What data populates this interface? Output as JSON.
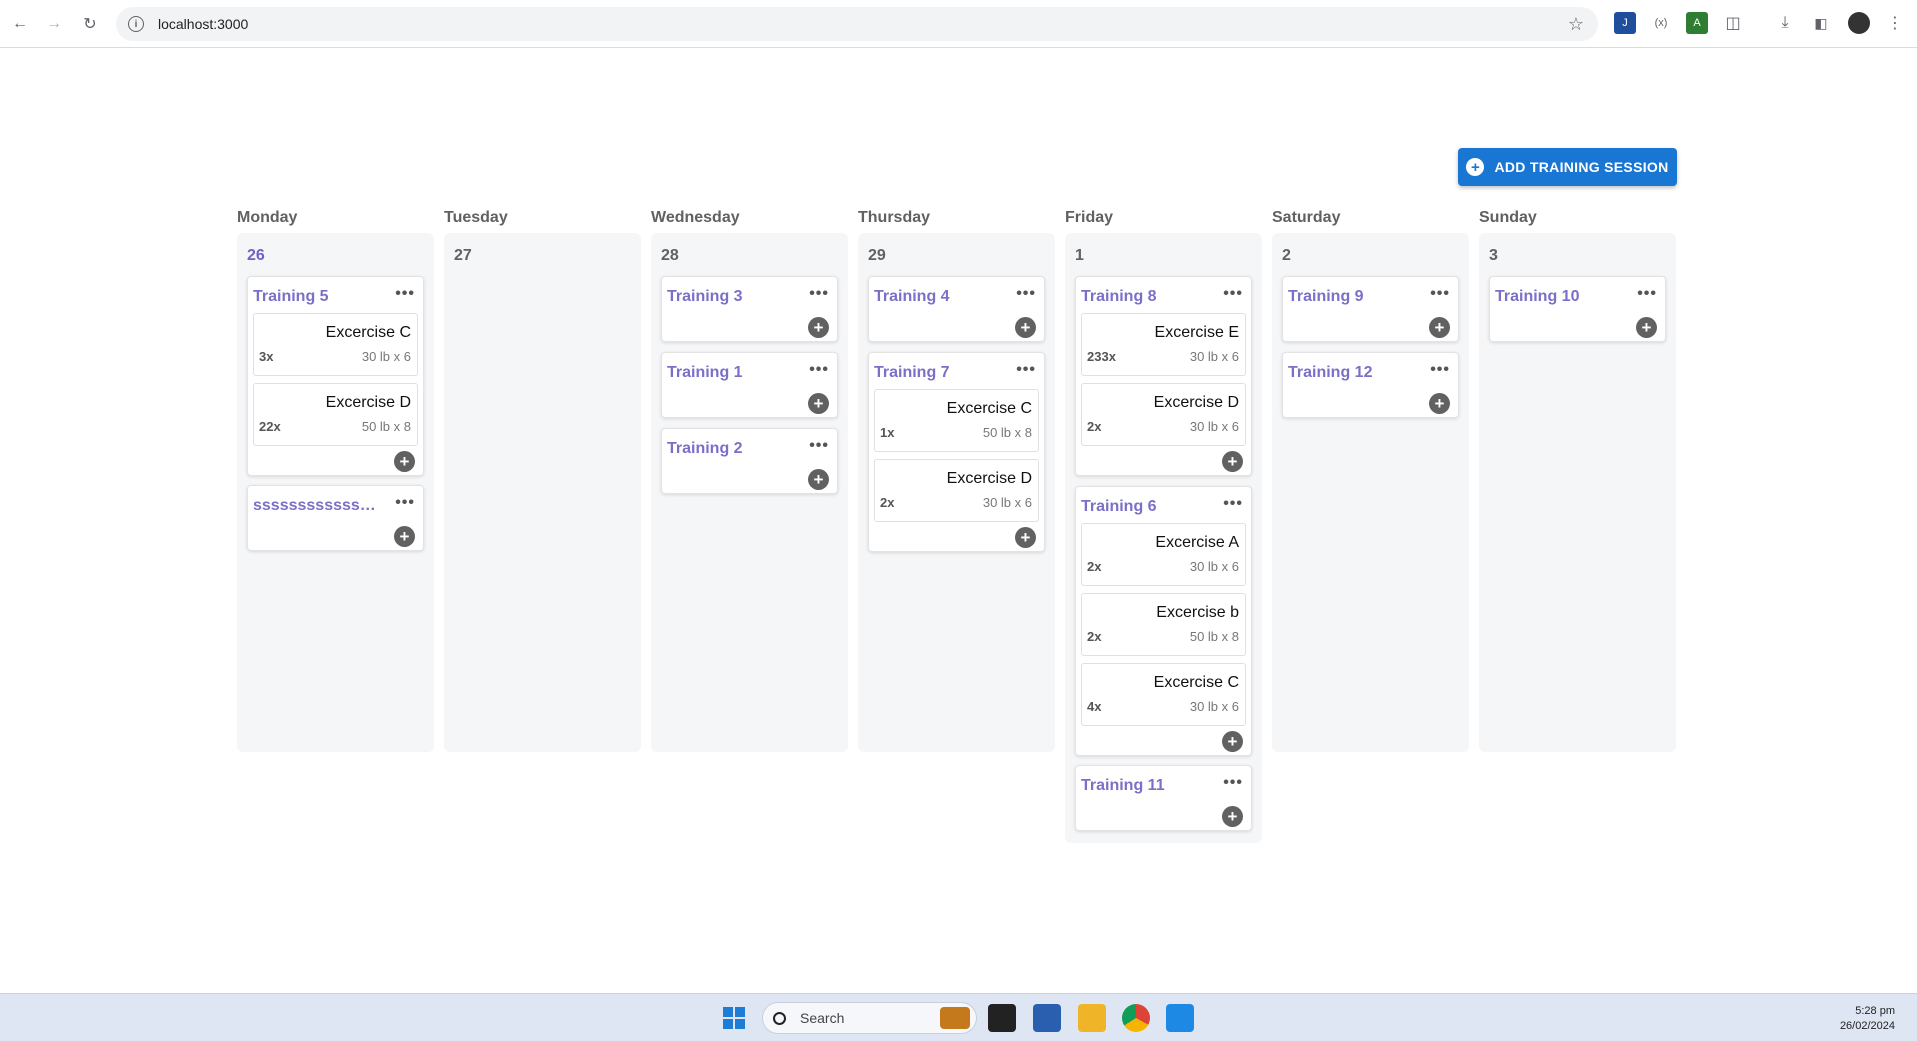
{
  "browser": {
    "url": "localhost:3000"
  },
  "toolbar": {
    "add_session_label": "ADD TRAINING SESSION"
  },
  "days": [
    {
      "name": "Monday",
      "number": "26",
      "today": true
    },
    {
      "name": "Tuesday",
      "number": "27"
    },
    {
      "name": "Wednesday",
      "number": "28"
    },
    {
      "name": "Thursday",
      "number": "29"
    },
    {
      "name": "Friday",
      "number": "1"
    },
    {
      "name": "Saturday",
      "number": "2"
    },
    {
      "name": "Sunday",
      "number": "3"
    }
  ],
  "sessions": {
    "monday": [
      {
        "title": "Training 5",
        "exercises": [
          {
            "name": "Excercise C",
            "count": "3x",
            "detail": "30 lb x 6"
          },
          {
            "name": "Excercise D",
            "count": "22x",
            "detail": "50 lb x 8"
          }
        ]
      },
      {
        "title": "sssssssssssssss",
        "exercises": []
      }
    ],
    "wednesday": [
      {
        "title": "Training 3",
        "exercises": []
      },
      {
        "title": "Training 1",
        "exercises": []
      },
      {
        "title": "Training 2",
        "exercises": []
      }
    ],
    "thursday": [
      {
        "title": "Training 4",
        "exercises": []
      },
      {
        "title": "Training 7",
        "exercises": [
          {
            "name": "Excercise C",
            "count": "1x",
            "detail": "50 lb x 8"
          },
          {
            "name": "Excercise D",
            "count": "2x",
            "detail": "30 lb x 6"
          }
        ]
      }
    ],
    "friday": [
      {
        "title": "Training 8",
        "exercises": [
          {
            "name": "Excercise E",
            "count": "233x",
            "detail": "30 lb x 6"
          },
          {
            "name": "Excercise D",
            "count": "2x",
            "detail": "30 lb x 6"
          }
        ]
      },
      {
        "title": "Training 6",
        "exercises": [
          {
            "name": "Excercise A",
            "count": "2x",
            "detail": "30 lb x 6"
          },
          {
            "name": "Excercise b",
            "count": "2x",
            "detail": "50 lb x 8"
          },
          {
            "name": "Excercise C",
            "count": "4x",
            "detail": "30 lb x 6"
          }
        ]
      },
      {
        "title": "Training 11",
        "exercises": []
      }
    ],
    "saturday": [
      {
        "title": "Training 9",
        "exercises": []
      },
      {
        "title": "Training 12",
        "exercises": []
      }
    ],
    "sunday": [
      {
        "title": "Training 10",
        "exercises": []
      }
    ]
  },
  "menu_glyph": "•••",
  "add_glyph": "+",
  "taskbar": {
    "search_label": "Search",
    "time": "5:28 pm",
    "date": "26/02/2024"
  },
  "colors": {
    "accent": "#1976d2",
    "session_title": "#7a70c8",
    "column_bg": "#f5f6f7"
  }
}
